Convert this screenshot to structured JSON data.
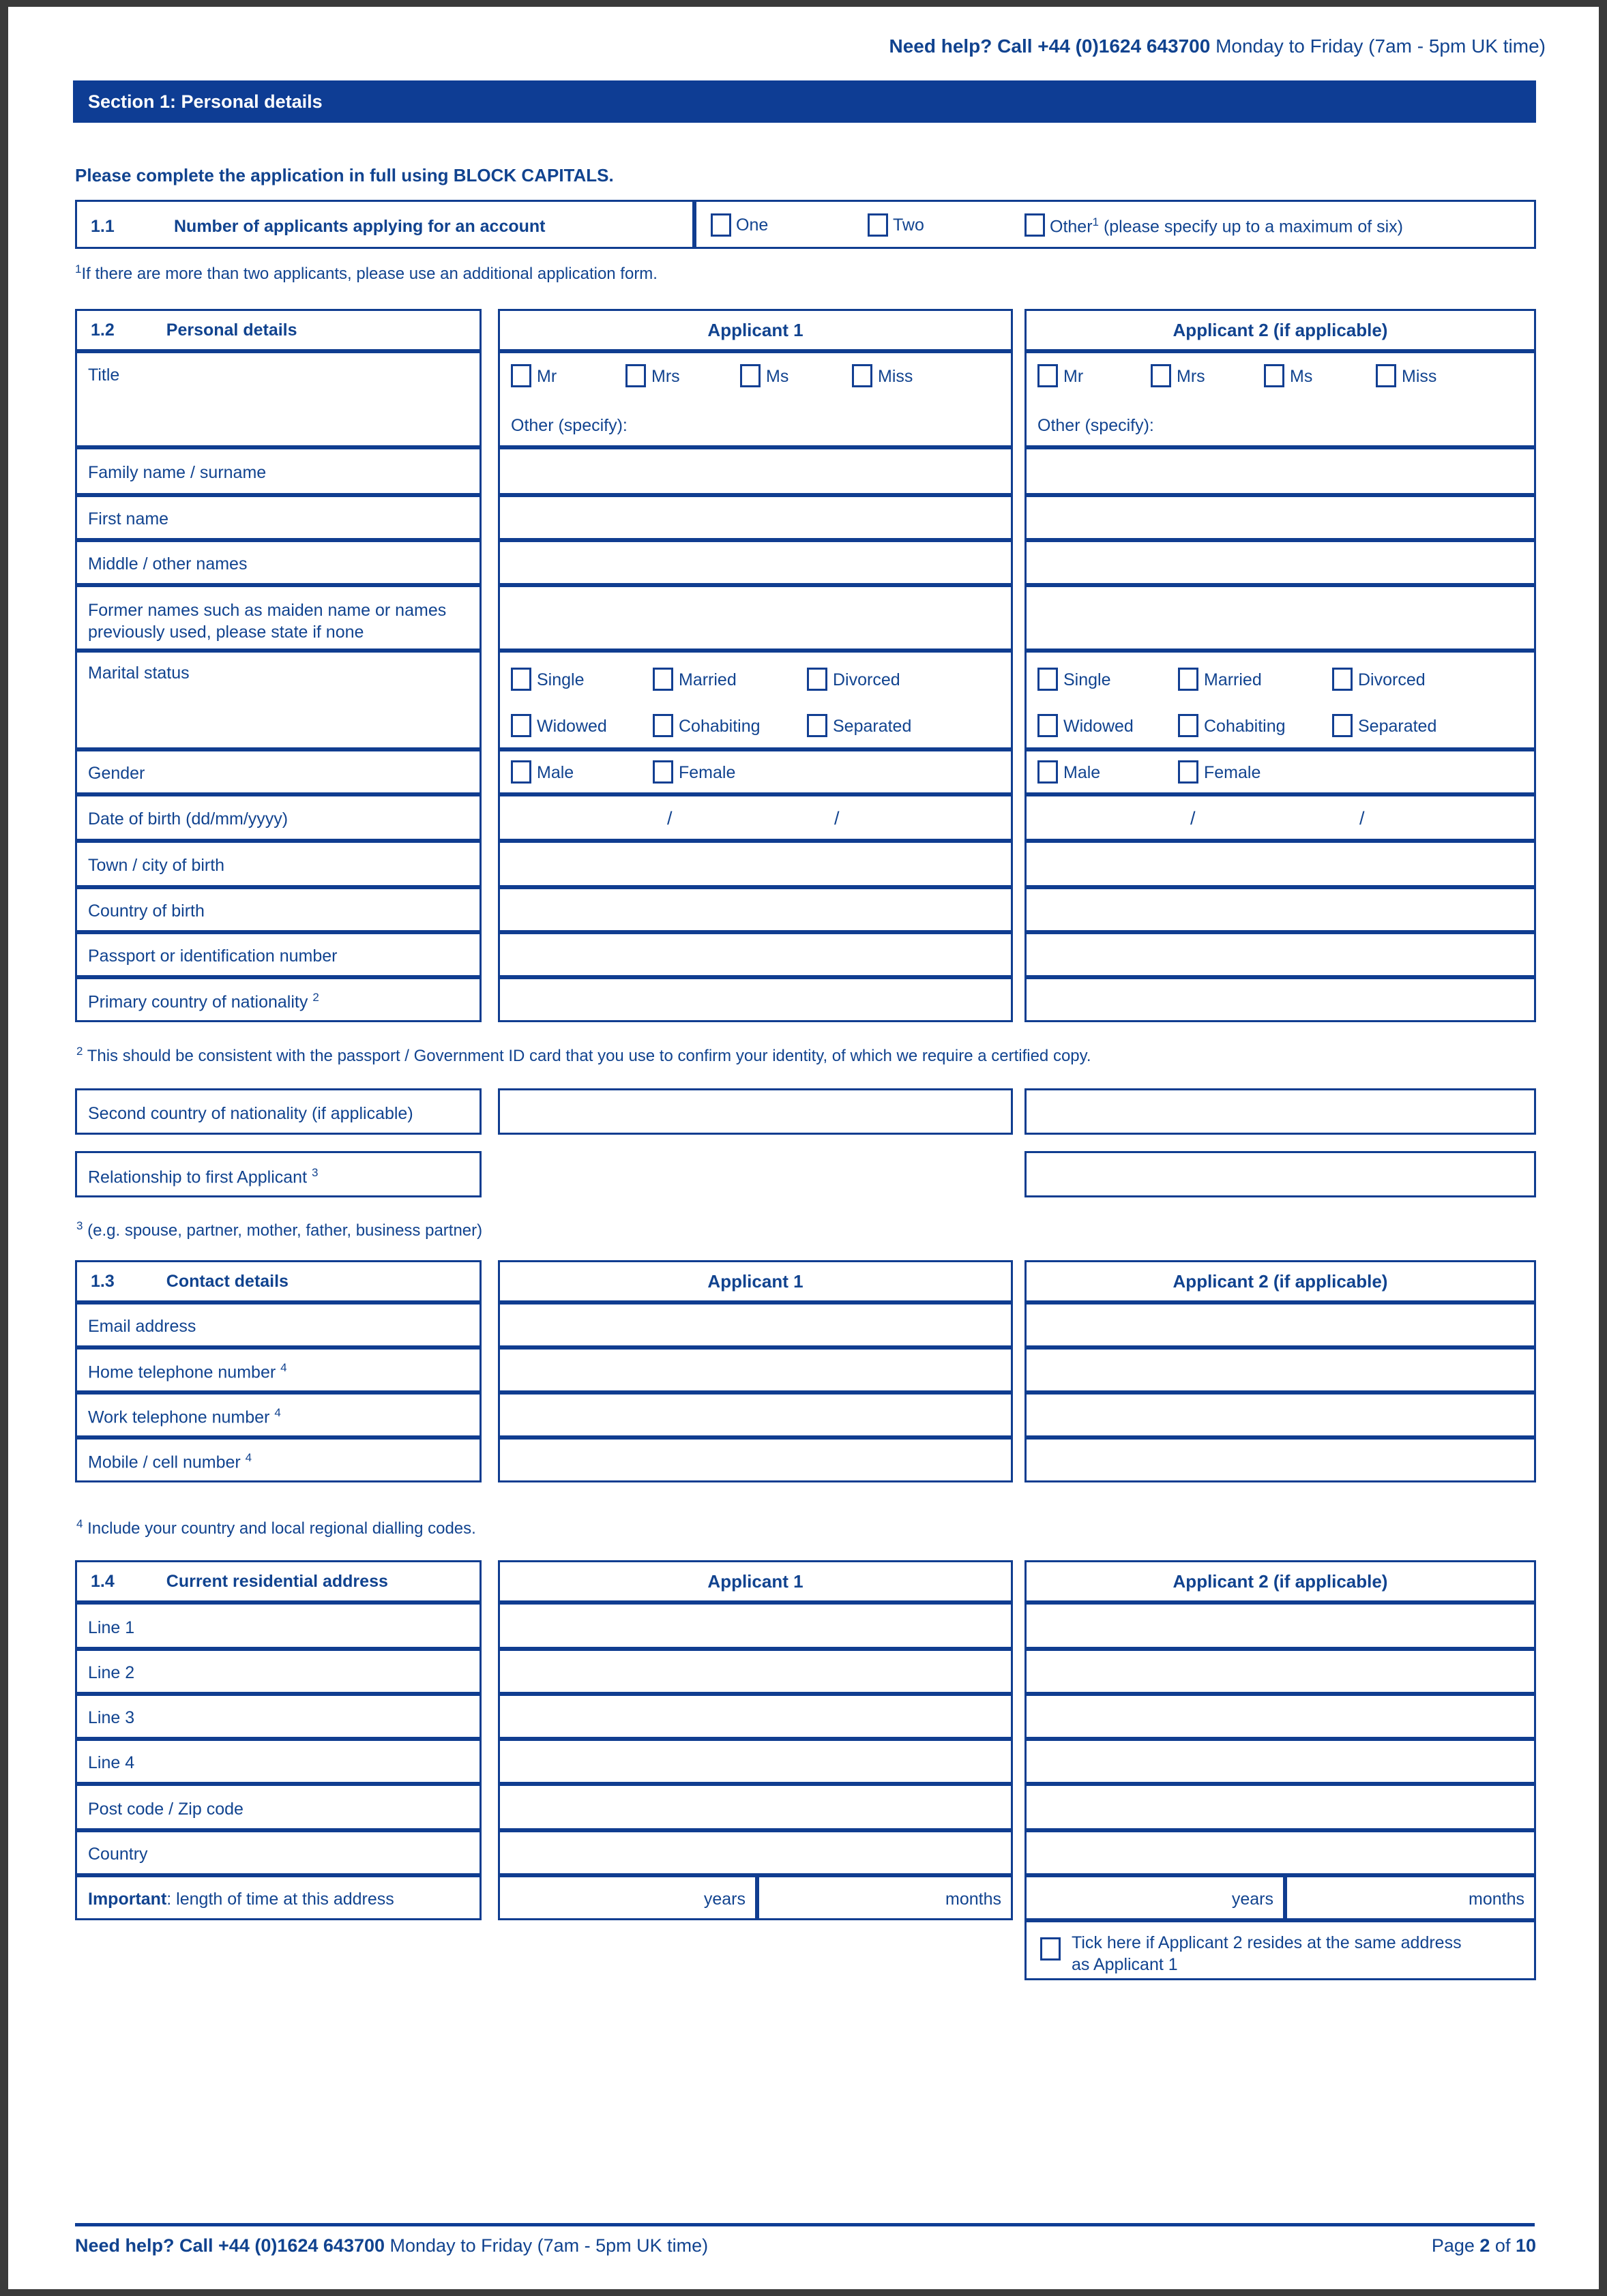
{
  "header": {
    "help_bold": "Need help?  Call  +44 (0)1624 643700",
    "help_rest": " Monday to Friday (7am - 5pm UK time)"
  },
  "section": {
    "title": "Section 1: Personal details",
    "instruction": "Please complete the application in full using BLOCK CAPITALS."
  },
  "q11": {
    "number": "1.1",
    "label": "Number of applicants applying for an account",
    "options": [
      "One",
      "Two"
    ],
    "other_label": "Other",
    "other_sup": "1",
    "other_rest": "(please specify up to a maximum of six)",
    "footnote": "If there are more than two applicants, please use an additional application form.",
    "footnote_sup": "1"
  },
  "q12": {
    "number": "1.2",
    "title": "Personal details",
    "col_applicant1": "Applicant 1",
    "col_applicant2": "Applicant 2 (if applicable)",
    "title_row_label": "Title",
    "title_options": [
      "Mr",
      "Mrs",
      "Ms",
      "Miss"
    ],
    "other_specify": "Other (specify):",
    "rows": [
      "Family name / surname",
      "First name",
      "Middle / other names",
      "Former names such as maiden name or names previously used, please state if none"
    ],
    "marital_label": "Marital status",
    "marital_options_row1": [
      "Single",
      "Married",
      "Divorced"
    ],
    "marital_options_row2": [
      "Widowed",
      "Cohabiting",
      "Separated"
    ],
    "gender_label": "Gender",
    "gender_options": [
      "Male",
      "Female"
    ],
    "dob_label": "Date of birth (dd/mm/yyyy)",
    "dob_separator": "/",
    "rows2": [
      "Town / city of birth",
      "Country of birth",
      "Passport or identification number"
    ],
    "nationality_label": "Primary country of nationality",
    "nationality_sup": "2",
    "footnote2_sup": "2",
    "footnote2": "This should be consistent with the passport / Government ID card that you use to confirm your identity, of which we require a certified copy.",
    "second_nationality_label": "Second country of nationality (if applicable)",
    "relationship_label": "Relationship to first Applicant",
    "relationship_sup": "3",
    "footnote3_sup": "3",
    "footnote3": "(e.g. spouse, partner, mother, father, business partner)"
  },
  "q13": {
    "number": "1.3",
    "title": "Contact details",
    "col_applicant1": "Applicant 1",
    "col_applicant2": "Applicant 2 (if applicable)",
    "rows": [
      {
        "label": "Email address",
        "sup": ""
      },
      {
        "label": "Home telephone number",
        "sup": "4"
      },
      {
        "label": "Work telephone number",
        "sup": "4"
      },
      {
        "label": "Mobile / cell number",
        "sup": "4"
      }
    ],
    "footnote4_sup": "4",
    "footnote4": "Include your country and local regional dialling codes."
  },
  "q14": {
    "number": "1.4",
    "title": "Current residential address",
    "col_applicant1": "Applicant 1",
    "col_applicant2": "Applicant 2 (if applicable)",
    "rows": [
      "Line 1",
      "Line 2",
      "Line 3",
      "Line 4",
      "Post code / Zip code",
      "Country"
    ],
    "important_bold": "Important",
    "important_rest": ": length of time at this address",
    "unit_years": "years",
    "unit_months": "months",
    "tick_line1": "Tick here if Applicant 2 resides at the same address",
    "tick_line2": "as Applicant 1"
  },
  "footer": {
    "help_bold": "Need help?  Call  +44 (0)1624 643700",
    "help_rest": " Monday to Friday (7am - 5pm UK time)",
    "page_prefix": "Page ",
    "page_current": "2",
    "page_mid": " of ",
    "page_total": "10"
  },
  "colors": {
    "brand_blue": "#0e3d94",
    "text_blue": "#11438f",
    "border_blue": "#103d90"
  }
}
